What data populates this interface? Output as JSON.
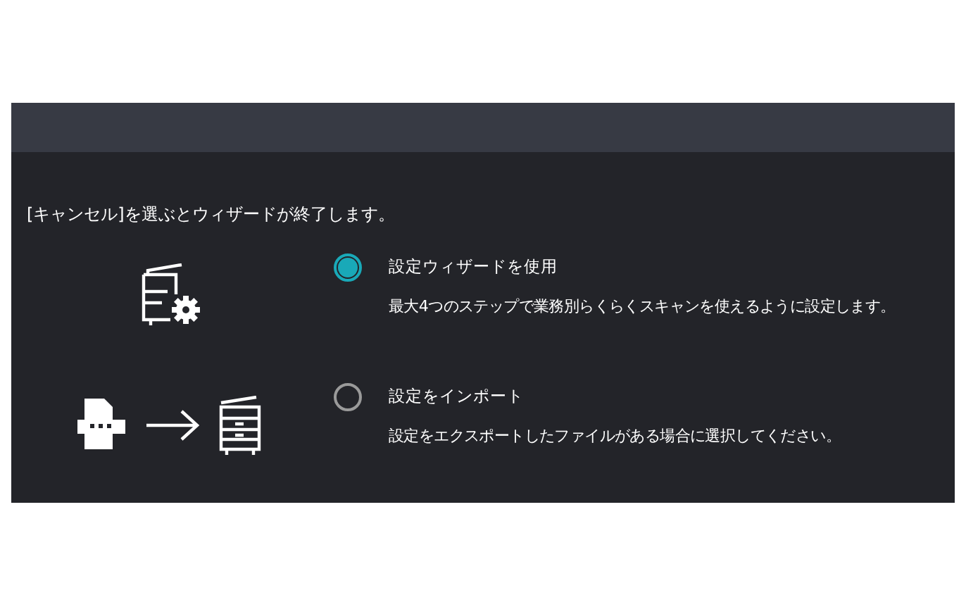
{
  "message": "[キャンセル]を選ぶとウィザードが終了します。",
  "options": [
    {
      "kind": "wizard",
      "label": "設定ウィザードを使用",
      "description": "最大4つのステップで業務別らくらくスキャンを使えるように設定します。",
      "selected": true
    },
    {
      "kind": "import",
      "label": "設定をインポート",
      "description": "設定をエクスポートしたファイルがある場合に選択してください。",
      "selected": false
    }
  ]
}
